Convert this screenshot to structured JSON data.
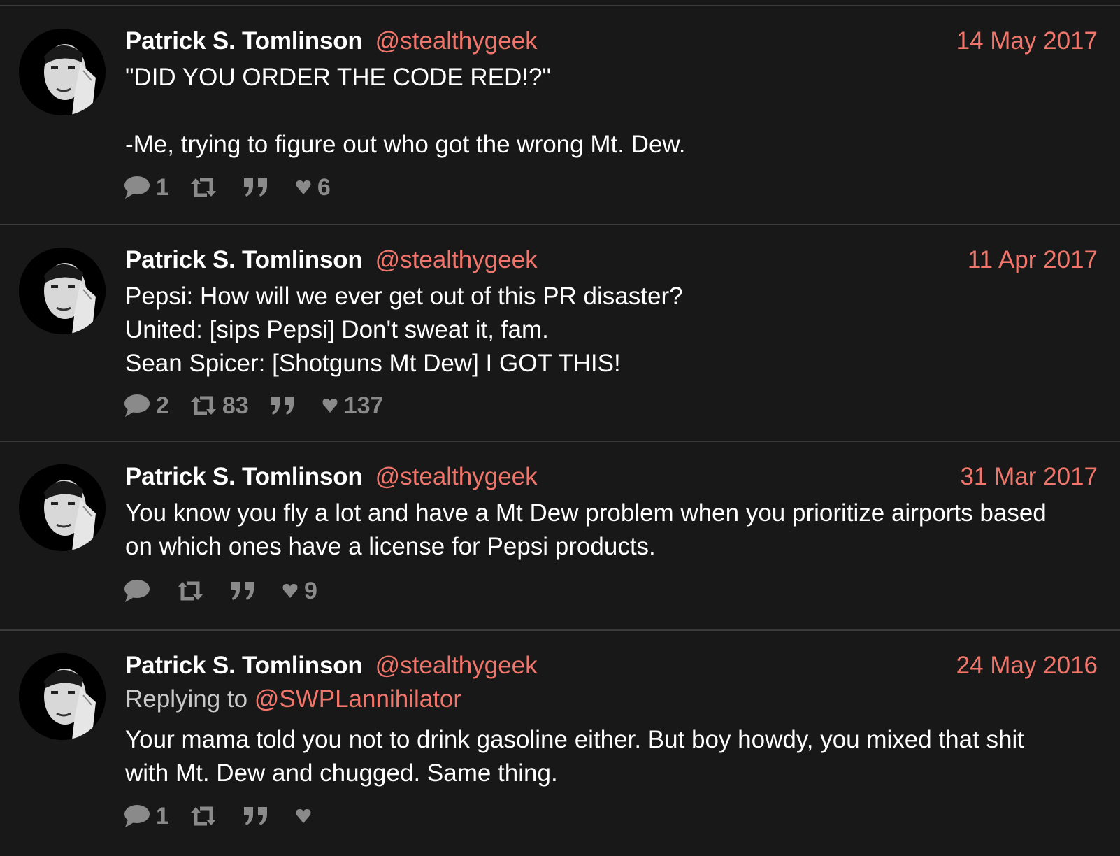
{
  "tweets": [
    {
      "author": {
        "name": "Patrick S. Tomlinson",
        "handle": "@stealthygeek",
        "avatar_icon": "avatar-photo"
      },
      "date": "14 May 2017",
      "reply_prefix": "",
      "reply_to": "",
      "text": "\"DID YOU ORDER THE CODE RED!?\"\n\n-Me, trying to figure out who got the wrong Mt. Dew.",
      "stats": {
        "replies": "1",
        "retweets": "",
        "quotes": "",
        "likes": "6"
      }
    },
    {
      "author": {
        "name": "Patrick S. Tomlinson",
        "handle": "@stealthygeek",
        "avatar_icon": "avatar-photo"
      },
      "date": "11 Apr 2017",
      "reply_prefix": "",
      "reply_to": "",
      "text": "Pepsi: How will we ever get out of this PR disaster?\nUnited: [sips Pepsi] Don't sweat it, fam.\nSean Spicer: [Shotguns Mt Dew] I GOT THIS!",
      "stats": {
        "replies": "2",
        "retweets": "83",
        "quotes": "",
        "likes": "137"
      }
    },
    {
      "author": {
        "name": "Patrick S. Tomlinson",
        "handle": "@stealthygeek",
        "avatar_icon": "avatar-photo"
      },
      "date": "31 Mar 2017",
      "reply_prefix": "",
      "reply_to": "",
      "text": "You know you fly a lot and have a Mt Dew problem when you prioritize airports based\non which ones have a license for Pepsi products.",
      "stats": {
        "replies": "",
        "retweets": "",
        "quotes": "",
        "likes": "9"
      }
    },
    {
      "author": {
        "name": "Patrick S. Tomlinson",
        "handle": "@stealthygeek",
        "avatar_icon": "avatar-photo"
      },
      "date": "24 May 2016",
      "reply_prefix": "Replying to ",
      "reply_to": "@SWPLannihilator",
      "text": "Your mama told you not to drink gasoline either. But boy howdy, you mixed that shit\nwith Mt. Dew and chugged. Same thing.",
      "stats": {
        "replies": "1",
        "retweets": "",
        "quotes": "",
        "likes": ""
      }
    }
  ],
  "icons": {
    "reply": "speech-bubble-icon",
    "retweet": "retweet-icon",
    "quote": "quote-icon",
    "like": "heart-icon"
  },
  "colors": {
    "background": "#181818",
    "accent": "#f0756a",
    "divider": "#3a3a3a",
    "muted": "#8a8a8a"
  }
}
